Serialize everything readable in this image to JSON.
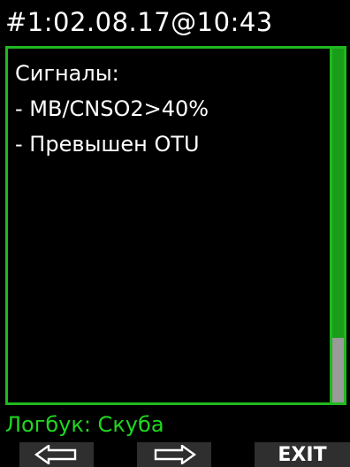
{
  "header": {
    "title": "#1:02.08.17@10:43"
  },
  "panel": {
    "lines": [
      "Сигналы:",
      "- MB/CNSO2>40%",
      "- Превышен OTU"
    ],
    "scroll_position": 0.83
  },
  "footer": {
    "title": "Логбук: Скуба"
  },
  "softkeys": {
    "left_icon": "arrow-left-icon",
    "right_icon": "arrow-right-icon",
    "exit_label": "EXIT"
  },
  "colors": {
    "accent": "#1fb81f",
    "footer_text": "#1fd81f",
    "background": "#000000",
    "softkey_bg": "#2f2f2f"
  }
}
